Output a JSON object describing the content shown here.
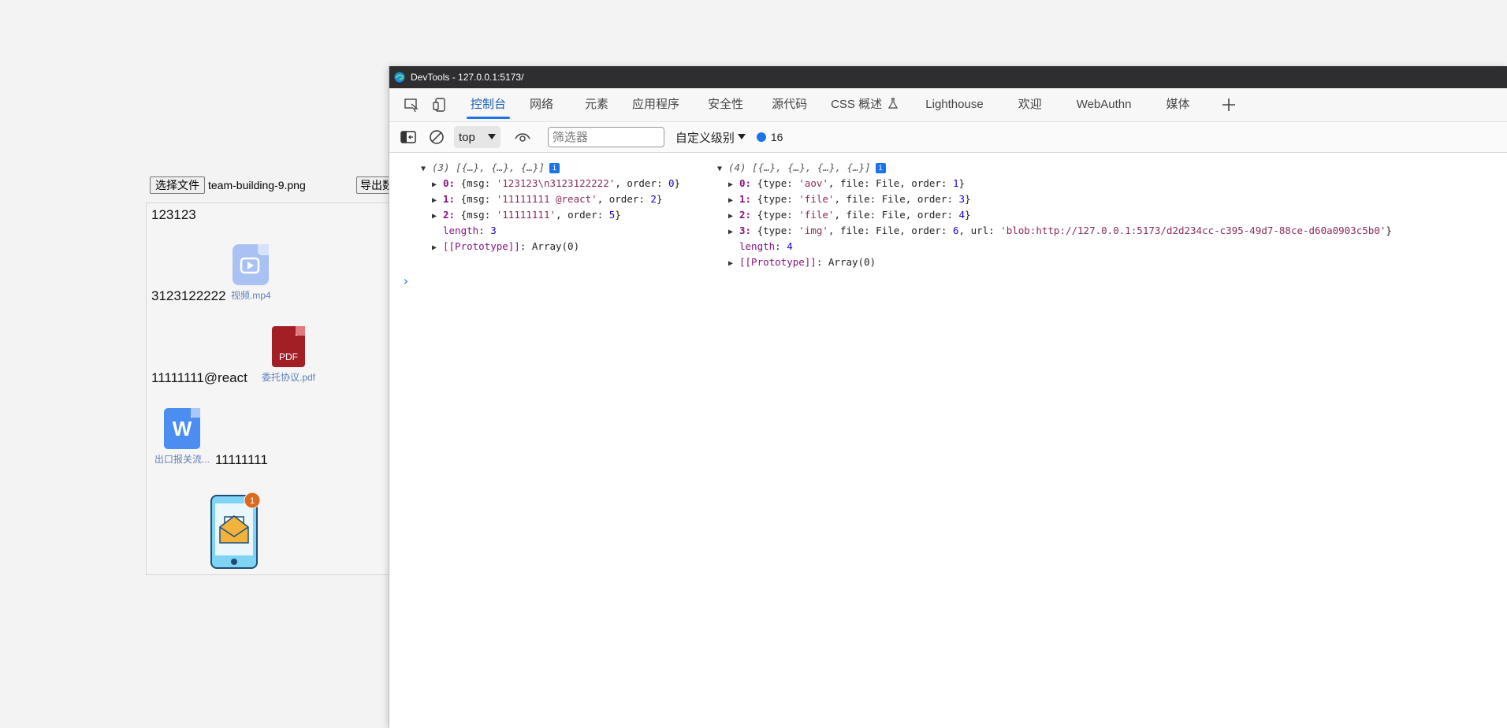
{
  "app": {
    "choose_file_label": "选择文件",
    "file_name": "team-building-9.png",
    "export_label": "导出数据",
    "editor": {
      "text1": "123123",
      "video_caption": "视频.mp4",
      "text2": "3123122222",
      "pdf_label": "PDF",
      "pdf_caption": "委托协议.pdf",
      "text3": "11111111@react",
      "word_letter": "W",
      "word_caption": "出口报关流...",
      "text4": "11111111",
      "badge_count": "1"
    }
  },
  "devtools": {
    "title": "DevTools - 127.0.0.1:5173/",
    "tabs": [
      "控制台",
      "网络",
      "元素",
      "应用程序",
      "安全性",
      "源代码",
      "CSS 概述",
      "Lighthouse",
      "欢迎",
      "WebAuthn",
      "媒体"
    ],
    "active_tab": "控制台",
    "toolbar": {
      "context": "top",
      "filter_placeholder": "筛选器",
      "level": "自定义级别",
      "issue_count": "16"
    },
    "console": {
      "log1": {
        "count": "(3)",
        "summary": "[{…}, {…}, {…}]",
        "items": [
          {
            "index": "0",
            "msg": "'123123\\n3123122222'",
            "order": "0"
          },
          {
            "index": "1",
            "msg": "'11111111 @react'",
            "order": "2"
          },
          {
            "index": "2",
            "msg": "'11111111'",
            "order": "5"
          }
        ],
        "length": "3",
        "prototype": "Array(0)"
      },
      "log2": {
        "count": "(4)",
        "summary": "[{…}, {…}, {…}, {…}]",
        "items": [
          {
            "index": "0",
            "type": "'aov'",
            "file": "File",
            "order": "1"
          },
          {
            "index": "1",
            "type": "'file'",
            "file": "File",
            "order": "3"
          },
          {
            "index": "2",
            "type": "'file'",
            "file": "File",
            "order": "4"
          },
          {
            "index": "3",
            "type": "'img'",
            "file": "File",
            "order": "6",
            "url": "'blob:http://127.0.0.1:5173/d2d234cc-c395-49d7-88ce-d60a0903c5b0'"
          }
        ],
        "length": "4",
        "prototype": "Array(0)"
      }
    }
  },
  "colors": {
    "accent": "#1a73e8",
    "titlebar": "#2e2e30",
    "pdf": "#a31f26",
    "word": "#4b8df0"
  }
}
